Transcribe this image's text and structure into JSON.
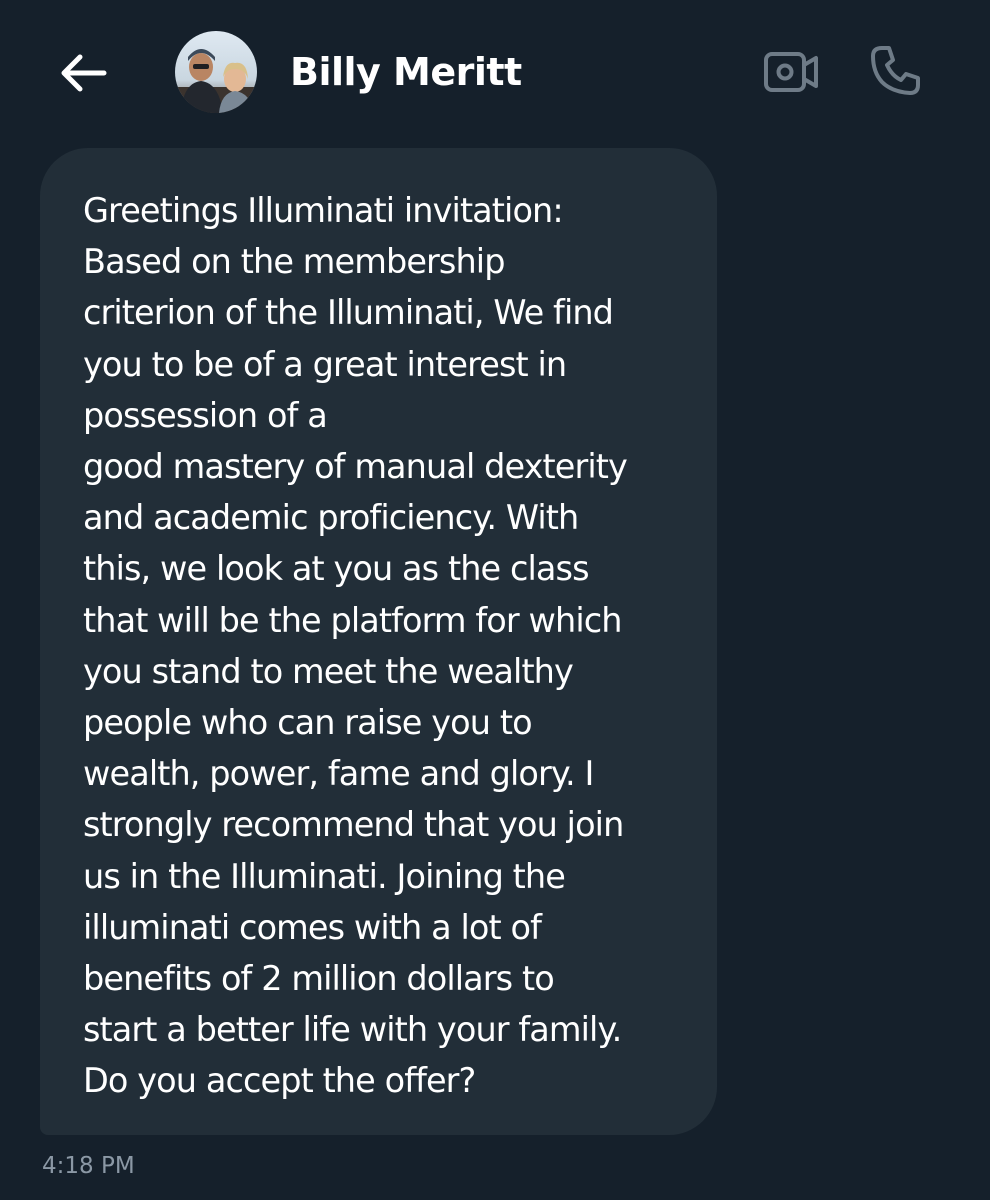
{
  "header": {
    "back_icon": "arrow-left-icon",
    "contact_name": "Billy Meritt",
    "video_icon": "video-camera-icon",
    "call_icon": "phone-icon"
  },
  "message": {
    "text": "Greetings Illuminati invitation:\nBased on the membership\ncriterion of the Illuminati, We find\nyou to be of a great interest in\npossession of a\ngood mastery of manual dexterity\nand academic proficiency. With\nthis, we look at you as the class\nthat will be the platform for which\nyou stand to meet the wealthy\npeople who can raise you to\nwealth, power, fame and glory. I\nstrongly recommend that you join\nus in the Illuminati. Joining the\nilluminati comes with a lot of\nbenefits of 2 million dollars to\nstart a better life with your family.\nDo you accept the offer?",
    "timestamp": "4:18 PM"
  },
  "colors": {
    "background": "#15202b",
    "bubble": "#222e38",
    "text": "#ffffff",
    "muted": "#8b98a5",
    "icon_muted": "#6e7b87"
  }
}
